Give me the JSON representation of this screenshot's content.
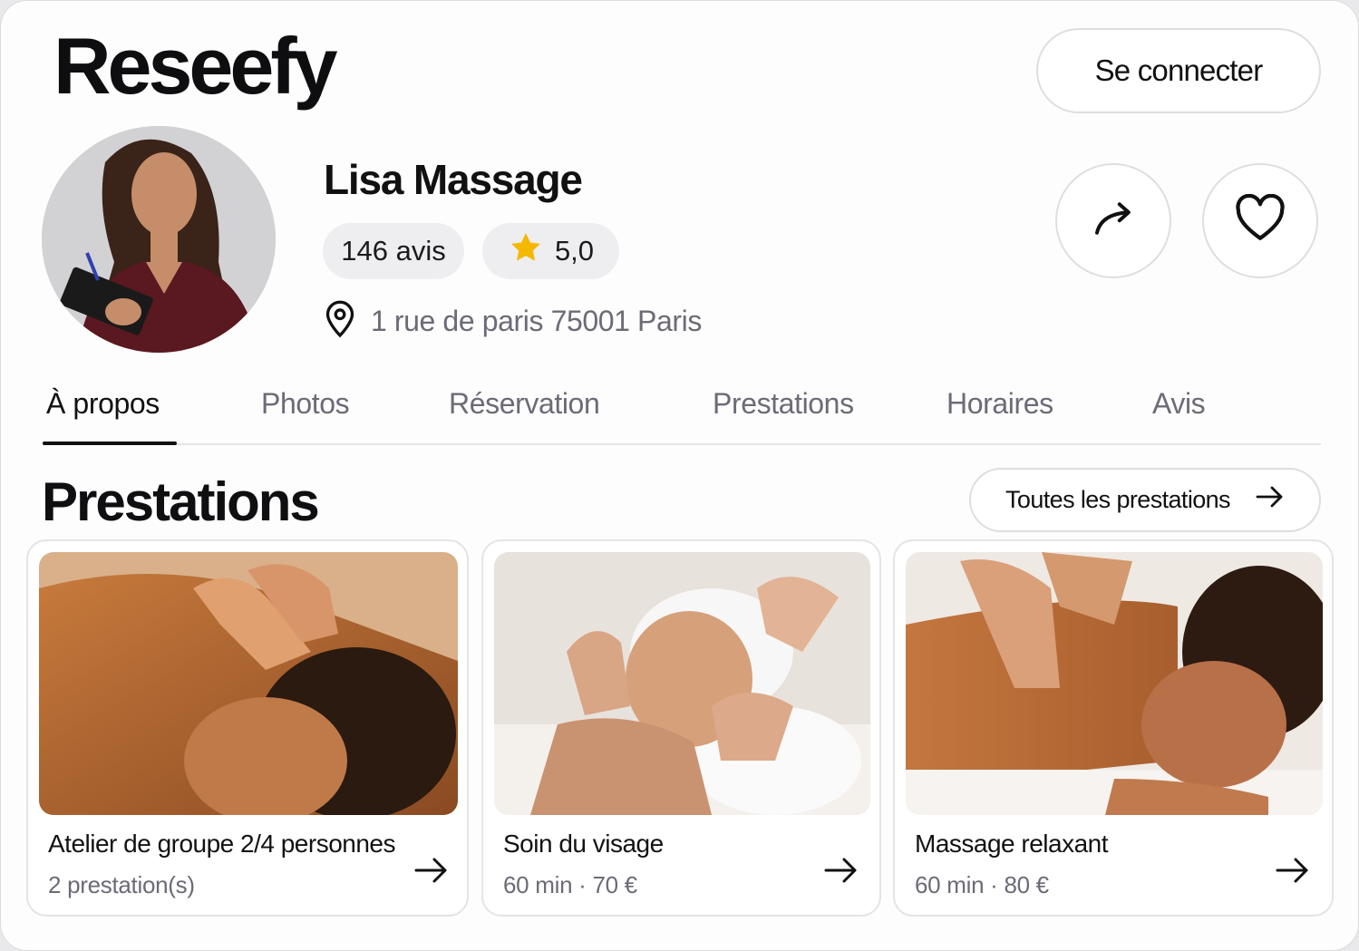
{
  "app": {
    "logo": "Reseefy"
  },
  "header": {
    "login_label": "Se connecter"
  },
  "profile": {
    "name": "Lisa Massage",
    "reviews_label": "146 avis",
    "rating": "5,0",
    "address": "1 rue de paris 75001 Paris"
  },
  "tabs": [
    {
      "label": "À propos",
      "active": true
    },
    {
      "label": "Photos"
    },
    {
      "label": "Réservation"
    },
    {
      "label": "Prestations"
    },
    {
      "label": "Horaires"
    },
    {
      "label": "Avis"
    }
  ],
  "services": {
    "title": "Prestations",
    "all_label": "Toutes les prestations",
    "items": [
      {
        "title": "Atelier de groupe 2/4 personnes",
        "subtitle": "2 prestation(s)"
      },
      {
        "title": "Soin du visage",
        "subtitle": "60 min · 70 €"
      },
      {
        "title": "Massage relaxant",
        "subtitle": "60 min · 80 €"
      }
    ]
  },
  "colors": {
    "text": "#111114",
    "muted": "#6b6b78",
    "star": "#f5b800",
    "border": "#dedee2",
    "pill_bg": "#eeeef0"
  },
  "icons": [
    "share-arrow-icon",
    "heart-icon",
    "star-icon",
    "location-pin-icon",
    "arrow-right-icon"
  ]
}
